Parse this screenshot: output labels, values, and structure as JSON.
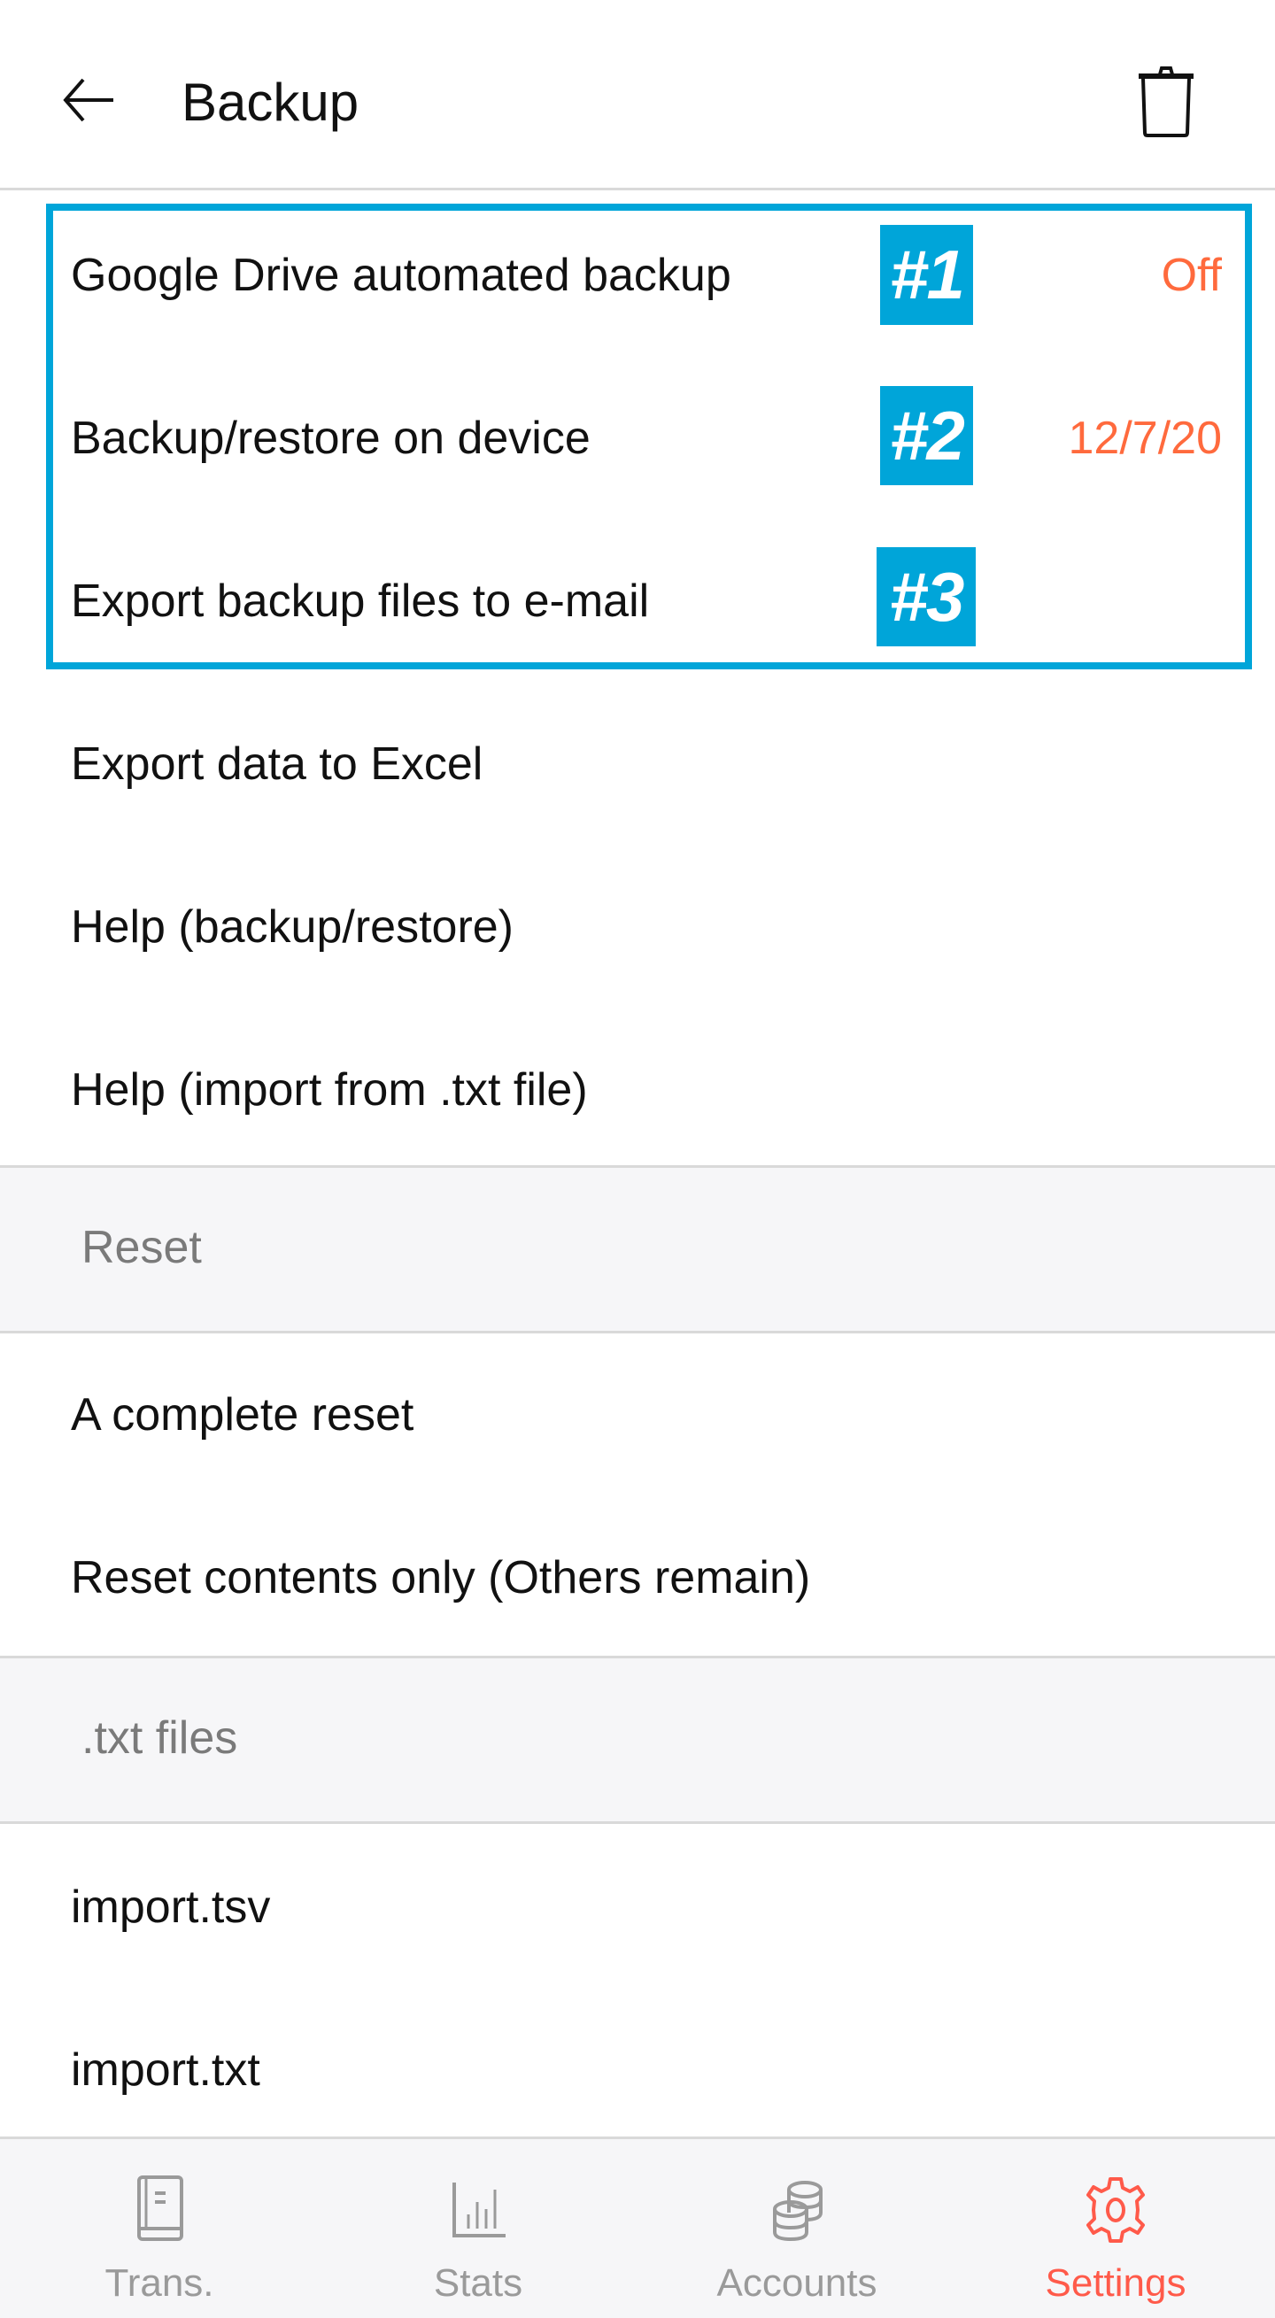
{
  "header": {
    "title": "Backup",
    "back_icon": "arrow-left-icon",
    "delete_icon": "trash-icon"
  },
  "colors": {
    "accent": "#ff6a3d",
    "highlight": "#00a5d9",
    "active_tab": "#ff5a4a",
    "inactive_tab": "#9a9a9a",
    "section_bg": "#f6f6f8"
  },
  "backup_items": [
    {
      "label": "Google Drive automated backup",
      "value": "Off",
      "badge": "#1"
    },
    {
      "label": "Backup/restore on device",
      "value": "12/7/20",
      "badge": "#2"
    },
    {
      "label": "Export backup files to e-mail",
      "value": "",
      "badge": "#3"
    },
    {
      "label": "Export data to Excel",
      "value": ""
    },
    {
      "label": "Help (backup/restore)",
      "value": ""
    },
    {
      "label": "Help (import from .txt file)",
      "value": ""
    }
  ],
  "sections": {
    "reset": {
      "title": "Reset",
      "items": [
        {
          "label": "A complete reset"
        },
        {
          "label": "Reset contents only (Others remain)"
        }
      ]
    },
    "txt_files": {
      "title": ".txt files",
      "items": [
        {
          "label": "import.tsv"
        },
        {
          "label": "import.txt"
        }
      ]
    }
  },
  "tabbar": {
    "tabs": [
      {
        "label": "Trans.",
        "icon": "book-icon",
        "active": false
      },
      {
        "label": "Stats",
        "icon": "bar-chart-icon",
        "active": false
      },
      {
        "label": "Accounts",
        "icon": "coins-icon",
        "active": false
      },
      {
        "label": "Settings",
        "icon": "gear-icon",
        "active": true
      }
    ]
  }
}
